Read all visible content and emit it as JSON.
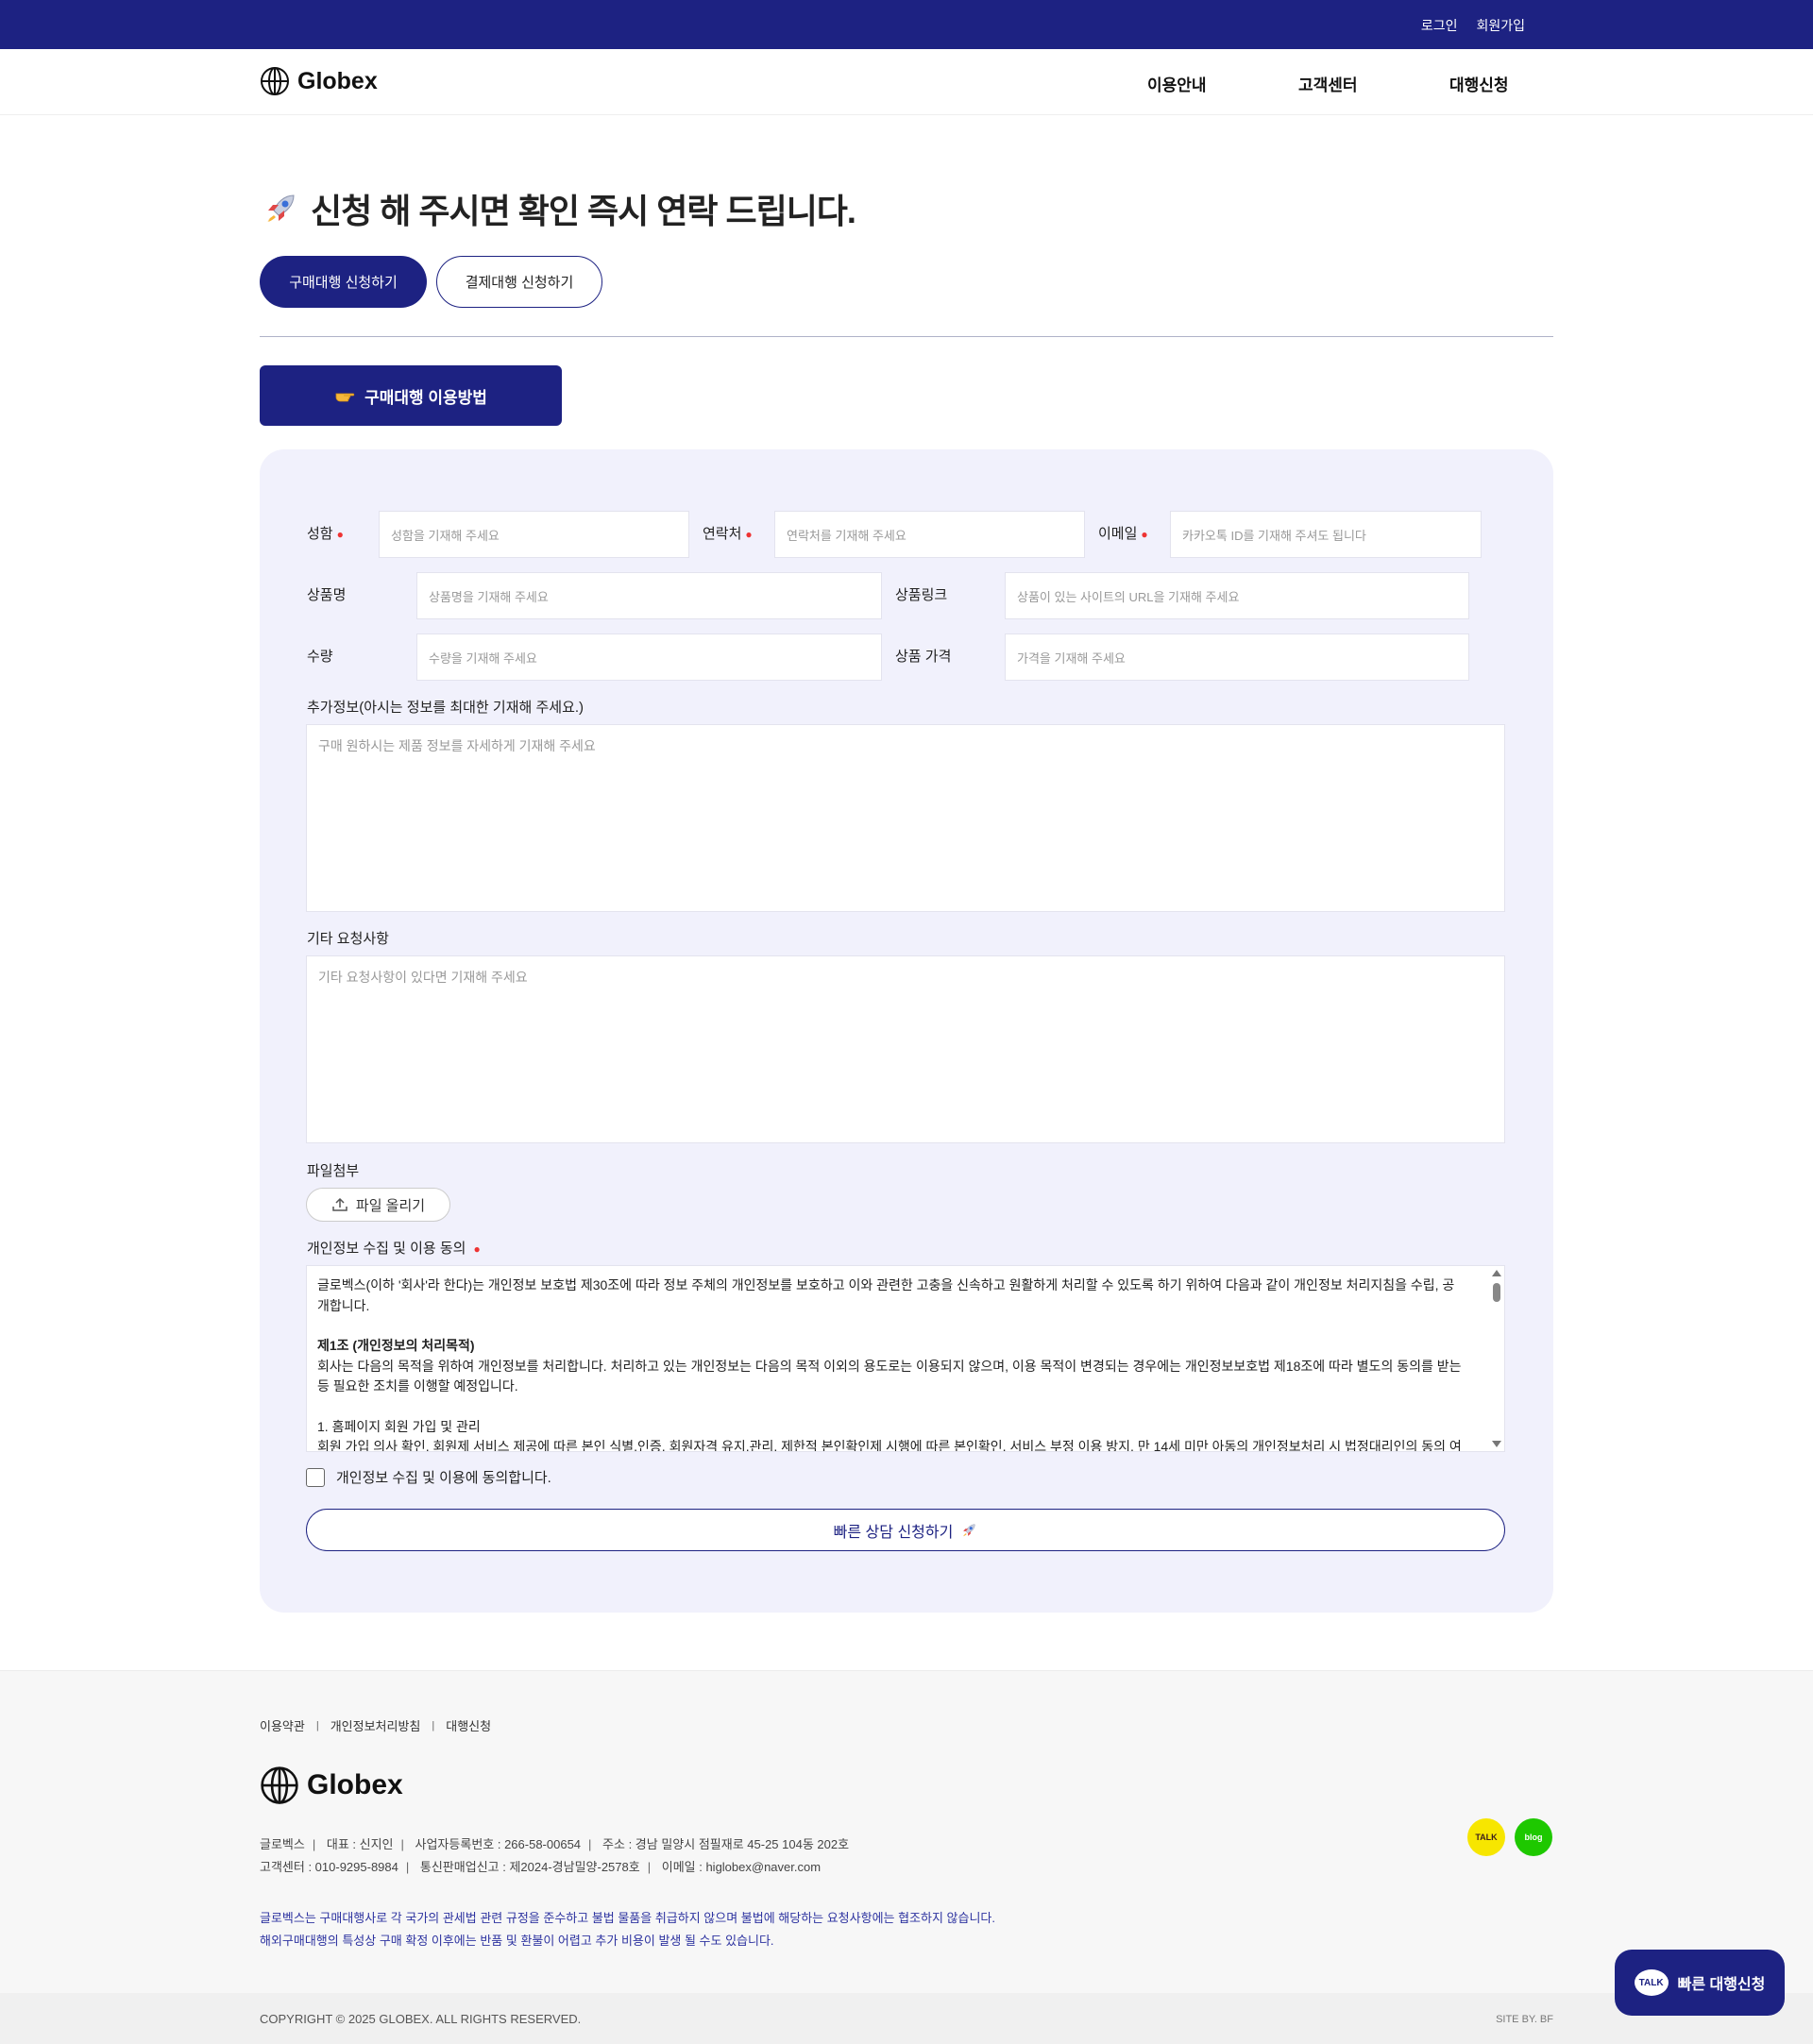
{
  "topbar": {
    "login": "로그인",
    "signup": "회원가입"
  },
  "header": {
    "logo": "Globex",
    "nav": [
      "이용안내",
      "고객센터",
      "대행신청"
    ]
  },
  "page": {
    "title": "신청 해 주시면 확인 즉시 연락 드립니다.",
    "title_icon": "rocket-icon",
    "tabs": [
      "구매대행 신청하기",
      "결제대행 신청하기"
    ],
    "howto_label": "구매대행 이용방법",
    "howto_icon": "pointing-hand-icon"
  },
  "form": {
    "name": {
      "label": "성함",
      "placeholder": "성함을 기재해 주세요"
    },
    "phone": {
      "label": "연락처",
      "placeholder": "연락처를 기재해 주세요"
    },
    "email": {
      "label": "이메일",
      "placeholder": "카카오톡 ID를 기재해 주셔도 됩니다"
    },
    "product": {
      "label": "상품명",
      "placeholder": "상품명을 기재해 주세요"
    },
    "link": {
      "label": "상품링크",
      "placeholder": "상품이 있는 사이트의 URL을 기재해 주세요"
    },
    "qty": {
      "label": "수량",
      "placeholder": "수량을 기재해 주세요"
    },
    "price": {
      "label": "상품 가격",
      "placeholder": "가격을 기재해 주세요"
    },
    "extra": {
      "label": "추가정보(아시는 정보를 최대한 기재해 주세요.)",
      "placeholder": "구매 원하시는 제품 정보를 자세하게 기재해 주세요"
    },
    "request": {
      "label": "기타 요청사항",
      "placeholder": "기타 요청사항이 있다면 기재해 주세요"
    },
    "file": {
      "label": "파일첨부",
      "button": "파일 올리기"
    },
    "privacy": {
      "label": "개인정보 수집 및 이용 동의",
      "intro": "글로벡스(이하 '회사'라 한다)는 개인정보 보호법 제30조에 따라 정보 주체의 개인정보를 보호하고 이와 관련한 고충을 신속하고 원활하게 처리할 수 있도록 하기 위하여 다음과 같이 개인정보 처리지침을 수립, 공개합니다.",
      "article_title": "제1조 (개인정보의 처리목적)",
      "article_body": "회사는 다음의 목적을 위하여 개인정보를 처리합니다. 처리하고 있는 개인정보는 다음의 목적 이외의 용도로는 이용되지 않으며, 이용 목적이 변경되는 경우에는 개인정보보호법 제18조에 따라 별도의 동의를 받는 등 필요한 조치를 이행할 예정입니다.",
      "item1_title": "1. 홈페이지 회원 가입 및 관리",
      "item1_body": "회원 가입 의사 확인, 회원제 서비스 제공에 따른 본인 식별.인증, 회원자격 유지.관리, 제한적 본인확인제 시행에 따른 본인확인, 서비스 부정 이용 방지, 만 14세 미만 아동의 개인정보처리 시 법정대리인의 동의 여부 확인, 각종 고지.통지, 고충 처리 등을 목적으로 개인정보를 처리합니다."
    },
    "agree_label": "개인정보 수집 및 이용에 동의합니다.",
    "submit": "빠른 상담 신청하기"
  },
  "footer": {
    "links": [
      "이용약관",
      "개인정보처리방침",
      "대행신청"
    ],
    "logo": "Globex",
    "info1": [
      "글로벡스",
      "대표 : 신지인",
      "사업자등록번호 : 266-58-00654",
      "주소 : 경남 밀양시 점필재로 45-25 104동 202호"
    ],
    "info2": [
      "고객센터 : 010-9295-8984",
      "통신판매업신고 : 제2024-경남밀양-2578호",
      "이메일 : higlobex@naver.com"
    ],
    "notice1": "글로벡스는 구매대행사로 각 국가의 관세법 관련 규정을 준수하고 불법 물품을 취급하지 않으며 불법에 해당하는 요청사항에는 협조하지 않습니다.",
    "notice2": "해외구매대행의 특성상 구매 확정 이후에는 반품 및 환불이 어렵고 추가 비용이 발생 될 수도 있습니다.",
    "social_talk": "TALK",
    "social_blog": "blog",
    "copyright": "COPYRIGHT © 2025 GLOBEX. ALL RIGHTS RESERVED.",
    "siteby": "SITE BY. BF"
  },
  "floating": {
    "talk": "TALK",
    "label": "빠른 대행신청"
  },
  "colors": {
    "brand": "#1d2282",
    "panel": "#f1f1fc",
    "required": "#e33333"
  }
}
